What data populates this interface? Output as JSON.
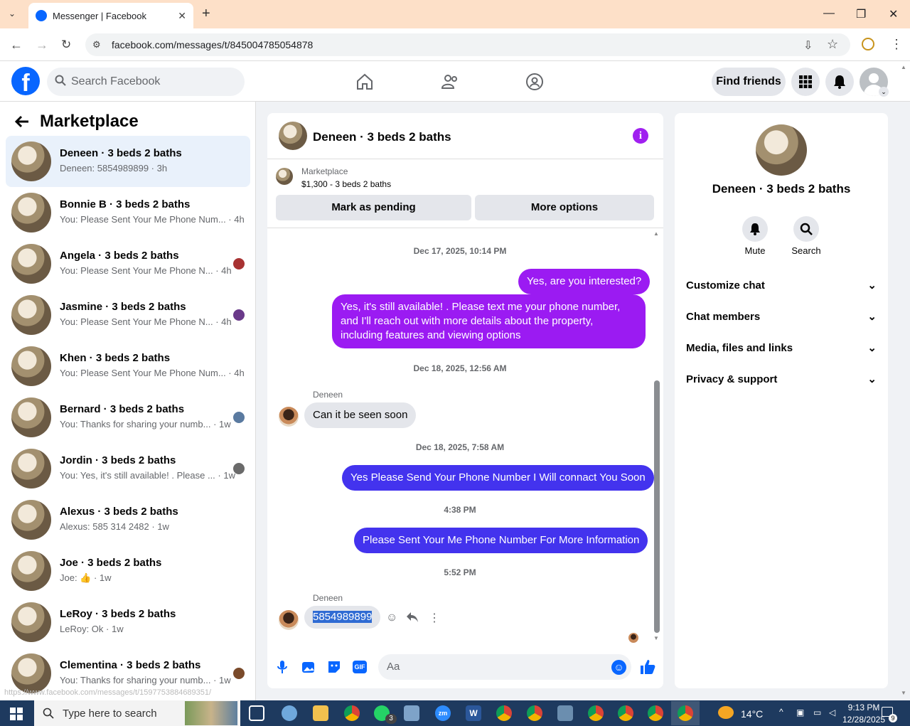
{
  "browser": {
    "tab_title": "Messenger | Facebook",
    "url": "facebook.com/messages/t/845004785054878",
    "status_url": "https://www.facebook.com/messages/t/1597753884689351/"
  },
  "header": {
    "search_placeholder": "Search Facebook",
    "find_friends": "Find friends"
  },
  "sidebar": {
    "title": "Marketplace",
    "conversations": [
      {
        "name": "Deneen · 3 beds 2 baths",
        "preview": "Deneen: 5854989899 · 3h"
      },
      {
        "name": "Bonnie B · 3 beds 2 baths",
        "preview": "You: Please Sent Your Me Phone Num... · 4h"
      },
      {
        "name": "Angela · 3 beds 2 baths",
        "preview": "You: Please Sent Your Me Phone N... · 4h"
      },
      {
        "name": "Jasmine · 3 beds 2 baths",
        "preview": "You: Please Sent Your Me Phone N... · 4h"
      },
      {
        "name": "Khen · 3 beds 2 baths",
        "preview": "You: Please Sent Your Me Phone Num... · 4h"
      },
      {
        "name": "Bernard · 3 beds 2 baths",
        "preview": "You: Thanks for sharing your numb... · 1w"
      },
      {
        "name": "Jordin · 3 beds 2 baths",
        "preview": "You: Yes, it's still available! . Please ... · 1w"
      },
      {
        "name": "Alexus · 3 beds 2 baths",
        "preview": "Alexus: 585 314 2482 · 1w"
      },
      {
        "name": "Joe · 3 beds 2 baths",
        "preview": "Joe: 👍 · 1w"
      },
      {
        "name": "LeRoy · 3 beds 2 baths",
        "preview": "LeRoy: Ok · 1w"
      },
      {
        "name": "Clementina · 3 beds 2 baths",
        "preview": "You: Thanks for sharing your numb... · 1w"
      }
    ]
  },
  "chat": {
    "title": "Deneen · 3 beds 2 baths",
    "marketplace_label": "Marketplace",
    "listing": "$1,300 - 3 beds 2 baths",
    "mark_pending": "Mark as pending",
    "more_options": "More options",
    "ts1": "Dec 17, 2025, 10:14 PM",
    "msg1": "Yes, are you interested?",
    "msg2": "Yes, it's still available! . Please text me your phone number, and I'll reach out with more details about the property, including features and viewing options",
    "ts2": "Dec 18, 2025, 12:56 AM",
    "sender_name": "Deneen",
    "msg3": "Can it be seen soon",
    "ts3": "Dec 18, 2025, 7:58 AM",
    "msg4": "Yes Please Send Your Phone Number I Will connact You Soon",
    "ts4": "4:38 PM",
    "msg5": "Please Sent Your Me Phone Number For More Information",
    "ts5": "5:52 PM",
    "msg6": "5854989899",
    "composer_placeholder": "Aa"
  },
  "details": {
    "name": "Deneen · 3 beds 2 baths",
    "mute": "Mute",
    "search": "Search",
    "sections": [
      "Customize chat",
      "Chat members",
      "Media, files and links",
      "Privacy & support"
    ]
  },
  "taskbar": {
    "search_placeholder": "Type here to search",
    "weather": "14°C",
    "time": "9:13 PM",
    "date": "12/28/2025",
    "notif_count": "9",
    "whatsapp_badge": "3"
  }
}
